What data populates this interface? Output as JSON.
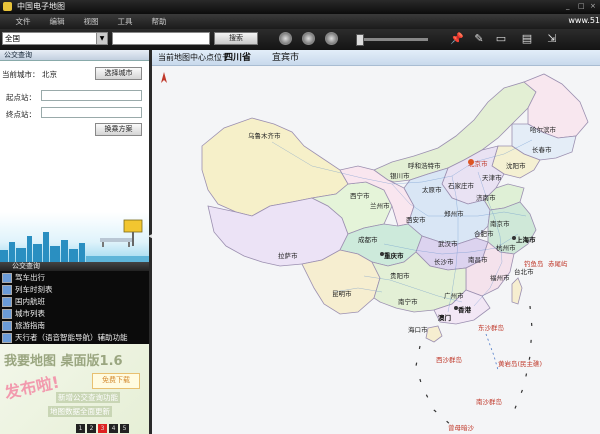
{
  "window": {
    "title": "中国电子地图",
    "url_fragment": "www.51"
  },
  "menu": [
    "文件",
    "编辑",
    "视图",
    "工具",
    "帮助"
  ],
  "toolbar": {
    "region_value": "全国",
    "search_button": "搜索"
  },
  "bus_panel": {
    "header": "公交查询",
    "current_city_label": "当前城市：",
    "current_city": "北京",
    "choose_city_button": "选择城市",
    "start_label": "起点站：",
    "end_label": "终点站：",
    "query_button": "换乘方案"
  },
  "services": {
    "header": "公交查询",
    "items": [
      "驾车出行",
      "列车时刻表",
      "国内航班",
      "城市列表",
      "旅游指南",
      "天行者（语音智能导航）辅助功能"
    ]
  },
  "ad": {
    "title": "我要地图 桌面版1.6",
    "download": "免费下载",
    "slogan": "发布啦!",
    "line1": "新增公交查询功能",
    "line2": "地图数据全面更新",
    "pages": [
      "1",
      "2",
      "3",
      "4",
      "5"
    ],
    "active_page": 3
  },
  "map": {
    "center_label": "当前地图中心点位于：",
    "province": "四川省",
    "city": "宜宾市",
    "cities": [
      {
        "name": "乌鲁木齐市"
      },
      {
        "name": "呼和浩特市"
      },
      {
        "name": "哈尔滨市"
      },
      {
        "name": "长春市"
      },
      {
        "name": "沈阳市"
      },
      {
        "name": "北京市"
      },
      {
        "name": "天津市"
      },
      {
        "name": "石家庄市"
      },
      {
        "name": "太原市"
      },
      {
        "name": "银川市"
      },
      {
        "name": "济南市"
      },
      {
        "name": "西宁市"
      },
      {
        "name": "兰州市"
      },
      {
        "name": "郑州市"
      },
      {
        "name": "西安市"
      },
      {
        "name": "南京市"
      },
      {
        "name": "上海市"
      },
      {
        "name": "合肥市"
      },
      {
        "name": "成都市"
      },
      {
        "name": "武汉市"
      },
      {
        "name": "杭州市"
      },
      {
        "name": "重庆市"
      },
      {
        "name": "拉萨市"
      },
      {
        "name": "长沙市"
      },
      {
        "name": "南昌市"
      },
      {
        "name": "贵阳市"
      },
      {
        "name": "福州市"
      },
      {
        "name": "台北市"
      },
      {
        "name": "昆明市"
      },
      {
        "name": "南宁市"
      },
      {
        "name": "广州市"
      },
      {
        "name": "香港"
      },
      {
        "name": "澳门"
      },
      {
        "name": "海口市"
      }
    ],
    "islands": [
      {
        "name": "钓鱼岛"
      },
      {
        "name": "赤尾屿"
      },
      {
        "name": "东沙群岛"
      },
      {
        "name": "西沙群岛"
      },
      {
        "name": "黄岩岛(民主礁)"
      },
      {
        "name": "南沙群岛"
      },
      {
        "name": "曾母暗沙"
      }
    ]
  }
}
